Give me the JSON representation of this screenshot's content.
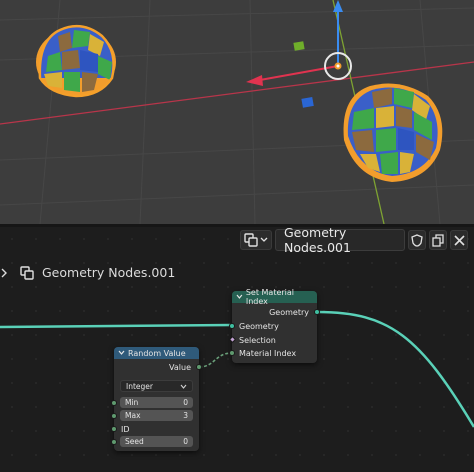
{
  "header": {
    "datablock_name": "Geometry Nodes.001"
  },
  "breadcrumb": {
    "tree_name": "Geometry Nodes.001"
  },
  "set_material_index_node": {
    "title": "Set Material Index",
    "output_geometry": "Geometry",
    "input_geometry": "Geometry",
    "input_selection": "Selection",
    "input_material_index": "Material Index"
  },
  "random_value_node": {
    "title": "Random Value",
    "output_value": "Value",
    "data_type": "Integer",
    "min_label": "Min",
    "min_value": "0",
    "max_label": "Max",
    "max_value": "3",
    "id_label": "ID",
    "seed_label": "Seed",
    "seed_value": "0"
  },
  "colors": {
    "geometry_wire": "#5ad1b8",
    "selection_outline": "#f29d2c",
    "x_axis": "#d4324a",
    "y_axis": "#8ac238",
    "z_axis": "#2b7fe0",
    "utility_header": "#2f5a7a",
    "geometry_header": "#266052"
  }
}
